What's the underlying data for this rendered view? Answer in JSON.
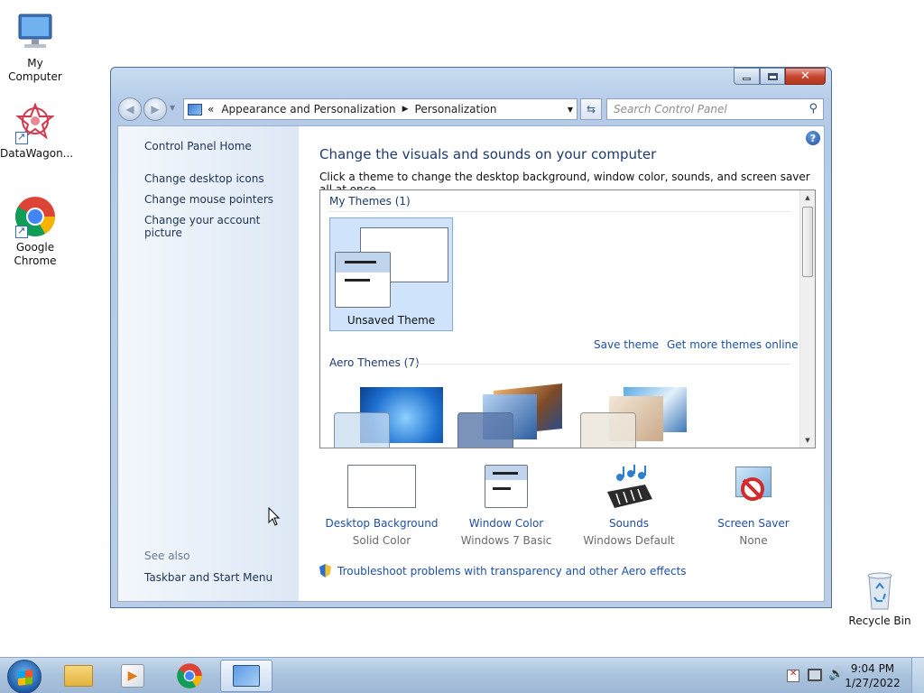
{
  "desktop": {
    "icons": [
      {
        "label": "My Computer"
      },
      {
        "label": "DataWagon..."
      },
      {
        "label": "Google Chrome"
      },
      {
        "label": "Recycle Bin"
      }
    ]
  },
  "window": {
    "address": {
      "overflow": "«",
      "crumb1": "Appearance and Personalization",
      "crumb2": "Personalization",
      "separator": "▶"
    },
    "search_placeholder": "Search Control Panel",
    "left_pane": {
      "links": [
        "Control Panel Home",
        "Change desktop icons",
        "Change mouse pointers",
        "Change your account picture"
      ],
      "see_also": "See also",
      "see_also_links": [
        "Taskbar and Start Menu"
      ]
    },
    "main": {
      "heading": "Change the visuals and sounds on your computer",
      "description": "Click a theme to change the desktop background, window color, sounds, and screen saver all at once.",
      "my_themes_header": "My Themes (1)",
      "unsaved_theme_label": "Unsaved Theme",
      "save_theme_link": "Save theme",
      "get_more_link": "Get more themes online",
      "aero_themes_header": "Aero Themes (7)",
      "settings": [
        {
          "name": "Desktop Background",
          "value": "Solid Color",
          "icon": "desktop-background-icon"
        },
        {
          "name": "Window Color",
          "value": "Windows 7 Basic",
          "icon": "window-color-icon"
        },
        {
          "name": "Sounds",
          "value": "Windows Default",
          "icon": "sounds-icon"
        },
        {
          "name": "Screen Saver",
          "value": "None",
          "icon": "screen-saver-icon"
        }
      ],
      "troubleshoot_link": "Troubleshoot problems with transparency and other Aero effects"
    }
  },
  "taskbar": {
    "time": "9:04 PM",
    "date": "1/27/2022"
  }
}
